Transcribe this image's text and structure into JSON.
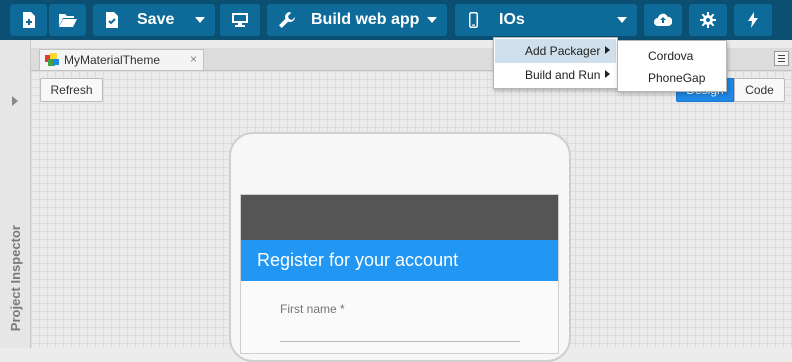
{
  "toolbar": {
    "save_label": "Save",
    "build_label": "Build web app",
    "platform_label": "IOs"
  },
  "sidebar": {
    "label": "Project Inspector"
  },
  "tabs": [
    {
      "label": "MyMaterialTheme",
      "close": "×"
    }
  ],
  "designer": {
    "refresh_label": "Refresh",
    "design_label": "Design",
    "code_label": "Code"
  },
  "preview": {
    "title": "Register for your account",
    "first_name_label": "First name *"
  },
  "dropdown": {
    "items": [
      {
        "label": "Add Packager"
      },
      {
        "label": "Build and Run"
      }
    ],
    "submenu": [
      {
        "label": "Cordova"
      },
      {
        "label": "PhoneGap"
      }
    ]
  },
  "colors": {
    "toolbar_bg": "#0b4f72",
    "button_bg": "#0e6b99",
    "accent": "#2196f3",
    "status_bar": "#555555"
  }
}
